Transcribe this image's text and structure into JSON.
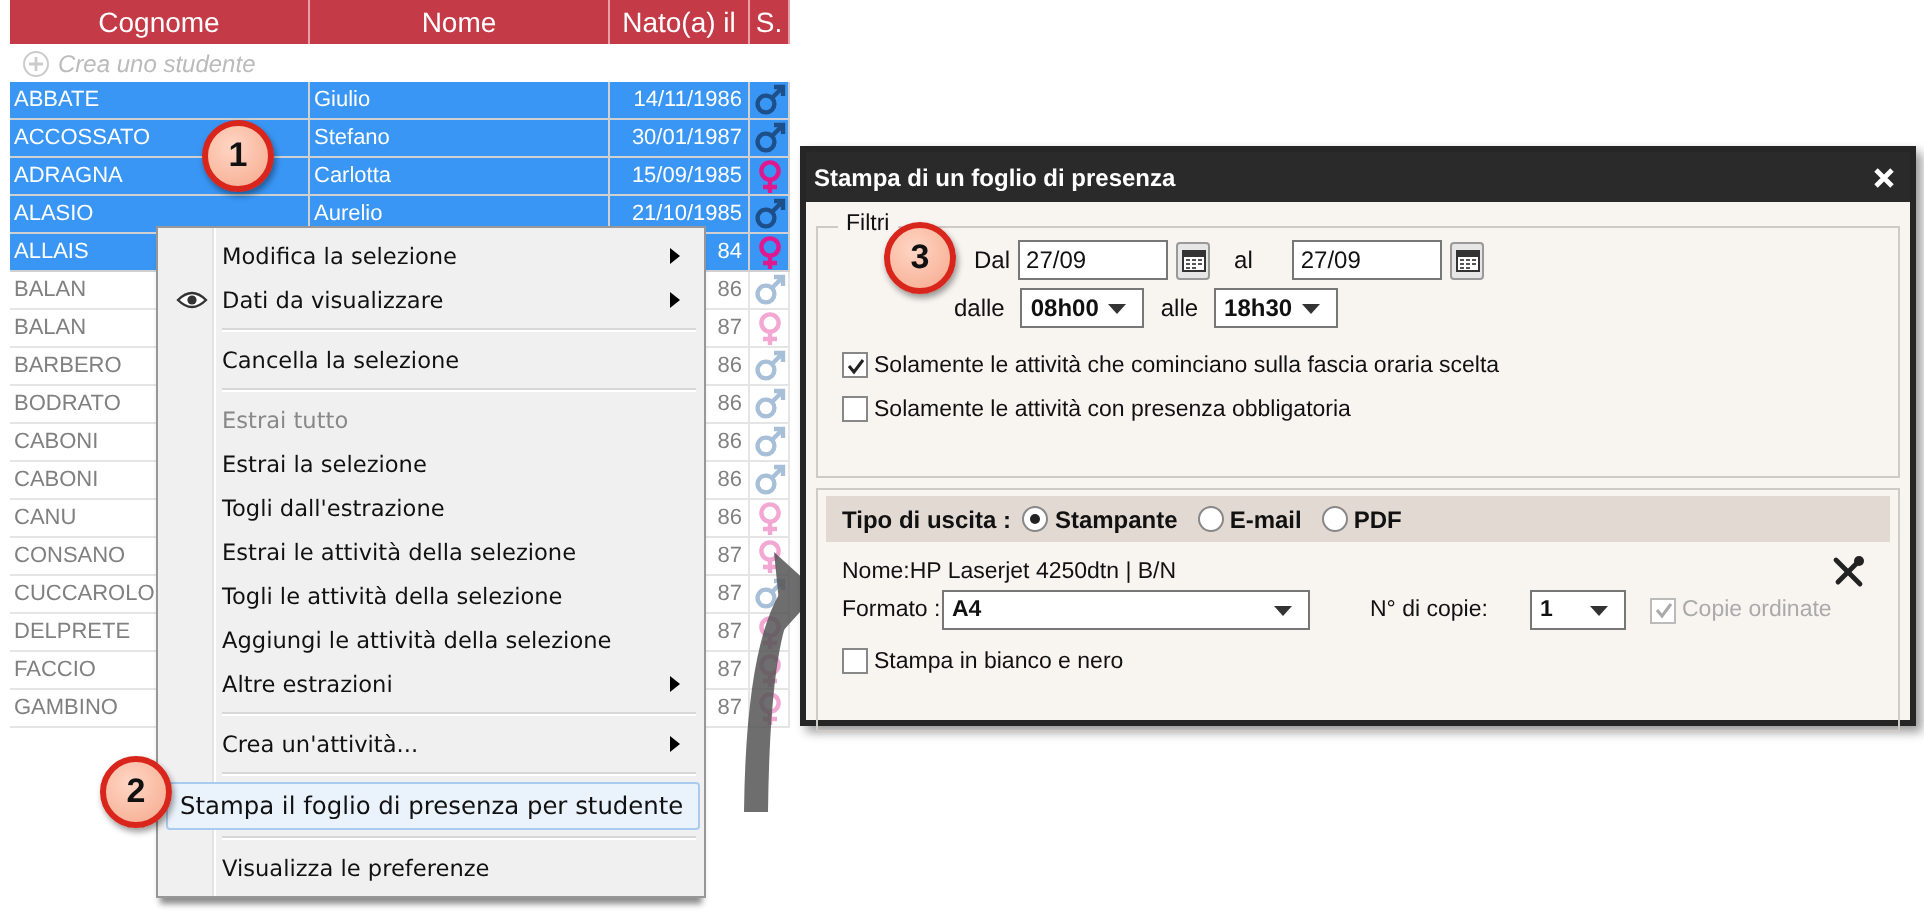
{
  "table": {
    "columns": [
      "Cognome",
      "Nome",
      "Nato(a) il",
      "S."
    ],
    "create_row": {
      "placeholder": "Crea uno studente"
    },
    "rows": [
      {
        "surname": "ABBATE",
        "name": "Giulio",
        "born": "14/11/1986",
        "kind": "male",
        "selected": true
      },
      {
        "surname": "ACCOSSATO",
        "name": "Stefano",
        "born": "30/01/1987",
        "kind": "male",
        "selected": true
      },
      {
        "surname": "ADRAGNA",
        "name": "Carlotta",
        "born": "15/09/1985",
        "kind": "female",
        "selected": true
      },
      {
        "surname": "ALASIO",
        "name": "Aurelio",
        "born": "21/10/1985",
        "kind": "male",
        "selected": true
      },
      {
        "surname": "ALLAIS",
        "born": "84",
        "kind": "female",
        "selected": true
      },
      {
        "surname": "BALAN",
        "born": "86",
        "kind": "male",
        "selected": false
      },
      {
        "surname": "BALAN",
        "born": "87",
        "kind": "female",
        "selected": false
      },
      {
        "surname": "BARBERO",
        "born": "86",
        "kind": "male",
        "selected": false
      },
      {
        "surname": "BODRATO",
        "born": "86",
        "kind": "male",
        "selected": false
      },
      {
        "surname": "CABONI",
        "born": "86",
        "kind": "male",
        "selected": false
      },
      {
        "surname": "CABONI",
        "born": "86",
        "kind": "male",
        "selected": false
      },
      {
        "surname": "CANU",
        "born": "86",
        "kind": "female",
        "selected": false
      },
      {
        "surname": "CONSANO",
        "born": "87",
        "kind": "female",
        "selected": false
      },
      {
        "surname": "CUCCAROLO",
        "born": "87",
        "kind": "male",
        "selected": false
      },
      {
        "surname": "DELPRETE",
        "born": "87",
        "kind": "female",
        "selected": false
      },
      {
        "surname": "FACCIO",
        "born": "87",
        "kind": "female",
        "selected": false
      },
      {
        "surname": "GAMBINO",
        "born": "87",
        "kind": "female",
        "selected": false
      }
    ]
  },
  "context_menu": {
    "items": [
      {
        "kind": "item",
        "label": "Modifica la selezione",
        "submenu": true,
        "disabled": false,
        "selected": false
      },
      {
        "kind": "eyeitem",
        "label": "Dati da visualizzare",
        "submenu": true,
        "disabled": false,
        "selected": false
      },
      {
        "kind": "separator"
      },
      {
        "kind": "item",
        "label": "Cancella la selezione",
        "submenu": false,
        "disabled": false,
        "selected": false
      },
      {
        "kind": "separator"
      },
      {
        "kind": "item",
        "label": "Estrai tutto",
        "submenu": false,
        "disabled": true,
        "selected": false
      },
      {
        "kind": "item",
        "label": "Estrai la selezione",
        "submenu": false,
        "disabled": false,
        "selected": false
      },
      {
        "kind": "item",
        "label": "Togli dall'estrazione",
        "submenu": false,
        "disabled": false,
        "selected": false
      },
      {
        "kind": "item",
        "label": "Estrai le attività della selezione",
        "submenu": false,
        "disabled": false,
        "selected": false
      },
      {
        "kind": "item",
        "label": "Togli le attività della selezione",
        "submenu": false,
        "disabled": false,
        "selected": false
      },
      {
        "kind": "item",
        "label": "Aggiungi le attività della selezione",
        "submenu": false,
        "disabled": false,
        "selected": false
      },
      {
        "kind": "item",
        "label": "Altre estrazioni",
        "submenu": true,
        "disabled": false,
        "selected": false
      },
      {
        "kind": "separator"
      },
      {
        "kind": "item",
        "label": "Crea un'attività...",
        "submenu": true,
        "disabled": false,
        "selected": false
      },
      {
        "kind": "separator"
      },
      {
        "kind": "item",
        "label": "Stampa il foglio di presenza per studente",
        "submenu": false,
        "disabled": false,
        "selected": true
      },
      {
        "kind": "separator"
      },
      {
        "kind": "item",
        "label": "Visualizza le preferenze",
        "submenu": false,
        "disabled": false,
        "selected": false
      }
    ]
  },
  "dialog": {
    "title": "Stampa di un foglio di presenza",
    "filters": {
      "legend": "Filtri",
      "from_label": "Dal",
      "from_date": "27/09",
      "to_label": "al",
      "to_date": "27/09",
      "from_time_label": "dalle",
      "from_time": "08h00",
      "to_time_label": "alle",
      "to_time": "18h30",
      "options": [
        {
          "label": "Solamente le attività che cominciano sulla fascia oraria scelta",
          "checked": true
        },
        {
          "label": "Solamente le attività con presenza obbligatoria",
          "checked": false
        }
      ]
    },
    "output": {
      "label": "Tipo di uscita :",
      "choices": [
        {
          "label": "Stampante",
          "selected": true
        },
        {
          "label": "E-mail",
          "selected": false
        },
        {
          "label": "PDF",
          "selected": false
        }
      ],
      "printer": "Nome:HP Laserjet 4250dtn | B/N",
      "format_label": "Formato :",
      "format": "A4",
      "copies_label": "N° di copie:",
      "copies": "1",
      "collate": {
        "label": "Copie ordinate",
        "checked": true,
        "disabled": true
      },
      "black_white": {
        "label": "Stampa in bianco e nero",
        "checked": false
      }
    }
  },
  "callouts": [
    "1",
    "2",
    "3"
  ]
}
